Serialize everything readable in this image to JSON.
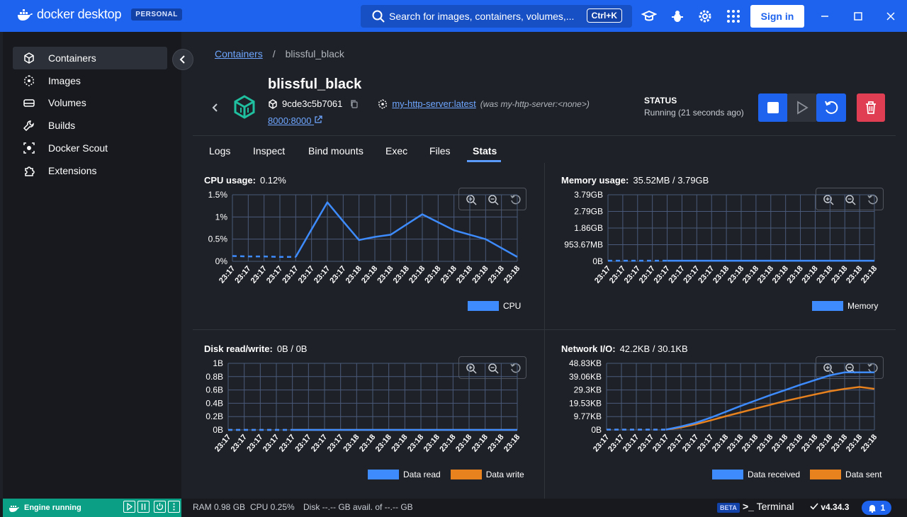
{
  "app": {
    "brand": "docker desktop",
    "plan_badge": "PERSONAL",
    "search_placeholder": "Search for images, containers, volumes,...",
    "search_shortcut": "Ctrl+K",
    "signin_label": "Sign in"
  },
  "sidebar": {
    "items": [
      {
        "label": "Containers",
        "icon": "containers-icon"
      },
      {
        "label": "Images",
        "icon": "images-icon"
      },
      {
        "label": "Volumes",
        "icon": "volumes-icon"
      },
      {
        "label": "Builds",
        "icon": "builds-icon"
      },
      {
        "label": "Docker Scout",
        "icon": "scout-icon"
      },
      {
        "label": "Extensions",
        "icon": "extensions-icon"
      }
    ]
  },
  "breadcrumb": {
    "parent": "Containers",
    "separator": "/",
    "current": "blissful_black"
  },
  "container": {
    "name": "blissful_black",
    "id": "9cde3c5b7061",
    "image": "my-http-server:latest",
    "image_note": "(was my-http-server:<none>)",
    "port": "8000:8000",
    "status_label": "STATUS",
    "status_value": "Running (21 seconds ago)"
  },
  "tabs": [
    "Logs",
    "Inspect",
    "Bind mounts",
    "Exec",
    "Files",
    "Stats"
  ],
  "active_tab": "Stats",
  "stats": {
    "cpu": {
      "title": "CPU usage:",
      "value": "0.12%"
    },
    "memory": {
      "title": "Memory usage:",
      "value": "35.52MB / 3.79GB"
    },
    "disk": {
      "title": "Disk read/write:",
      "value": "0B / 0B"
    },
    "network": {
      "title": "Network I/O:",
      "value": "42.2KB / 30.1KB"
    }
  },
  "chart_data": [
    {
      "type": "line",
      "title": "CPU usage",
      "x": [
        "23:17",
        "23:17",
        "23:17",
        "23:17",
        "23:17",
        "23:17",
        "23:17",
        "23:17",
        "23:18",
        "23:18",
        "23:18",
        "23:18",
        "23:18",
        "23:18",
        "23:18",
        "23:18",
        "23:18",
        "23:18",
        "23:18"
      ],
      "y_ticks": [
        "0%",
        "0.5%",
        "1%",
        "1.5%"
      ],
      "ylim": [
        0,
        1.5
      ],
      "dashed_until_index": 4,
      "series": [
        {
          "name": "CPU",
          "color": "#3d8bfd",
          "values": [
            0.12,
            0.11,
            0.11,
            0.1,
            0.1,
            0.72,
            1.33,
            0.9,
            0.48,
            0.55,
            0.6,
            0.83,
            1.06,
            0.88,
            0.7,
            0.6,
            0.5,
            0.3,
            0.1
          ]
        }
      ]
    },
    {
      "type": "line",
      "title": "Memory usage",
      "x": [
        "23:17",
        "23:17",
        "23:17",
        "23:17",
        "23:17",
        "23:17",
        "23:17",
        "23:17",
        "23:18",
        "23:18",
        "23:18",
        "23:18",
        "23:18",
        "23:18",
        "23:18",
        "23:18",
        "23:18",
        "23:18",
        "23:18"
      ],
      "y_ticks": [
        "0B",
        "953.67MB",
        "1.86GB",
        "2.79GB",
        "3.79GB"
      ],
      "ylim": [
        0,
        3.79
      ],
      "dashed_until_index": 4,
      "series": [
        {
          "name": "Memory",
          "color": "#3d8bfd",
          "values": [
            0.035,
            0.035,
            0.035,
            0.035,
            0.035,
            0.035,
            0.035,
            0.035,
            0.035,
            0.035,
            0.035,
            0.035,
            0.035,
            0.035,
            0.035,
            0.035,
            0.035,
            0.035,
            0.035
          ]
        }
      ]
    },
    {
      "type": "line",
      "title": "Disk read/write",
      "x": [
        "23:17",
        "23:17",
        "23:17",
        "23:17",
        "23:17",
        "23:17",
        "23:17",
        "23:17",
        "23:18",
        "23:18",
        "23:18",
        "23:18",
        "23:18",
        "23:18",
        "23:18",
        "23:18",
        "23:18",
        "23:18",
        "23:18"
      ],
      "y_ticks": [
        "0B",
        "0.2B",
        "0.4B",
        "0.6B",
        "0.8B",
        "1B"
      ],
      "ylim": [
        0,
        1
      ],
      "dashed_until_index": 4,
      "series": [
        {
          "name": "Data read",
          "color": "#3d8bfd",
          "values": [
            0,
            0,
            0,
            0,
            0,
            0,
            0,
            0,
            0,
            0,
            0,
            0,
            0,
            0,
            0,
            0,
            0,
            0,
            0
          ]
        },
        {
          "name": "Data write",
          "color": "#e8821e",
          "values": [
            0,
            0,
            0,
            0,
            0,
            0,
            0,
            0,
            0,
            0,
            0,
            0,
            0,
            0,
            0,
            0,
            0,
            0,
            0
          ]
        }
      ]
    },
    {
      "type": "line",
      "title": "Network I/O",
      "x": [
        "23:17",
        "23:17",
        "23:17",
        "23:17",
        "23:17",
        "23:17",
        "23:17",
        "23:17",
        "23:18",
        "23:18",
        "23:18",
        "23:18",
        "23:18",
        "23:18",
        "23:18",
        "23:18",
        "23:18",
        "23:18",
        "23:18"
      ],
      "y_ticks": [
        "0B",
        "9.77KB",
        "19.53KB",
        "29.3KB",
        "39.06KB",
        "48.83KB"
      ],
      "ylim": [
        0,
        48.83
      ],
      "dashed_until_index": 4,
      "series": [
        {
          "name": "Data received",
          "color": "#3d8bfd",
          "values": [
            0.2,
            0.2,
            0.2,
            0.2,
            0.2,
            2.5,
            5.2,
            9,
            13.2,
            17.5,
            21.5,
            25.5,
            29.2,
            33,
            36.5,
            40,
            42.2,
            42.2,
            42.2
          ]
        },
        {
          "name": "Data sent",
          "color": "#e8821e",
          "values": [
            0.2,
            0.2,
            0.2,
            0.2,
            0.2,
            1.8,
            4.2,
            7,
            10,
            12.8,
            15.6,
            18.4,
            21.2,
            23.6,
            26,
            28.3,
            30.1,
            31.5,
            30.1
          ]
        }
      ]
    }
  ],
  "statusbar": {
    "engine": "Engine running",
    "ram": "RAM 0.98 GB",
    "cpu": "CPU 0.25%",
    "disk": "Disk --.-- GB avail. of --.-- GB",
    "beta": "BETA",
    "terminal": "Terminal",
    "version": "v4.34.3",
    "notifications": "1"
  }
}
